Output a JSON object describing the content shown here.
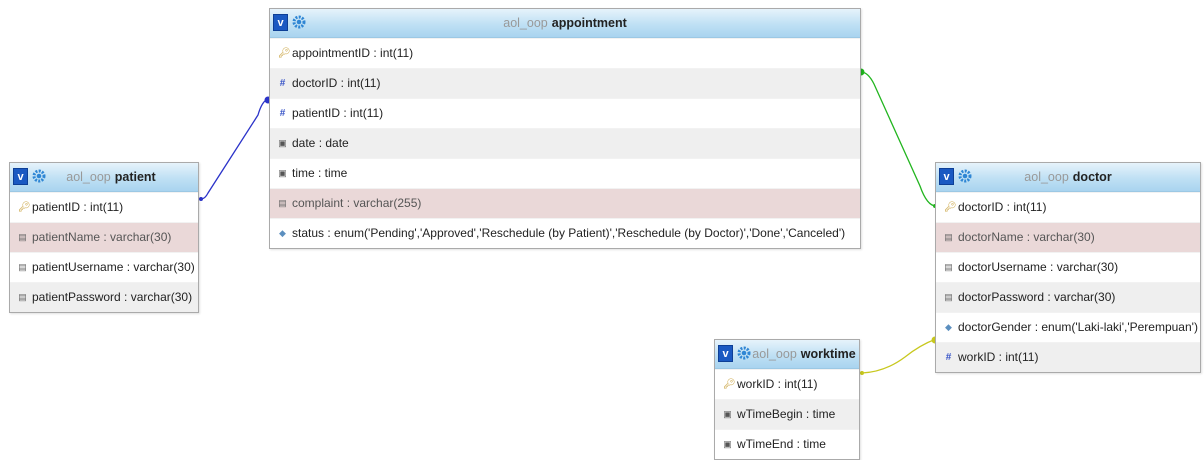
{
  "tables": {
    "appointment": {
      "db": "aol_oop",
      "name": "appointment",
      "fields": [
        {
          "icon": "primary-key-icon",
          "label": "appointmentID : int(11)"
        },
        {
          "icon": "index-icon",
          "label": "doctorID : int(11)"
        },
        {
          "icon": "index-icon",
          "label": "patientID : int(11)"
        },
        {
          "icon": "date-icon",
          "label": "date : date"
        },
        {
          "icon": "date-icon",
          "label": "time : time"
        },
        {
          "icon": "text-field-icon",
          "label": "complaint : varchar(255)"
        },
        {
          "icon": "enum-icon",
          "label": "status : enum('Pending','Approved','Reschedule (by Patient)','Reschedule (by Doctor)','Done','Canceled')"
        }
      ]
    },
    "patient": {
      "db": "aol_oop",
      "name": "patient",
      "fields": [
        {
          "icon": "primary-key-icon",
          "label": "patientID : int(11)"
        },
        {
          "icon": "text-field-icon",
          "label": "patientName : varchar(30)"
        },
        {
          "icon": "text-field-icon",
          "label": "patientUsername : varchar(30)"
        },
        {
          "icon": "text-field-icon",
          "label": "patientPassword : varchar(30)"
        }
      ]
    },
    "doctor": {
      "db": "aol_oop",
      "name": "doctor",
      "fields": [
        {
          "icon": "primary-key-icon",
          "label": "doctorID : int(11)"
        },
        {
          "icon": "text-field-icon",
          "label": "doctorName : varchar(30)"
        },
        {
          "icon": "text-field-icon",
          "label": "doctorUsername : varchar(30)"
        },
        {
          "icon": "text-field-icon",
          "label": "doctorPassword : varchar(30)"
        },
        {
          "icon": "enum-icon",
          "label": "doctorGender : enum('Laki-laki','Perempuan')"
        },
        {
          "icon": "index-icon",
          "label": "workID : int(11)"
        }
      ]
    },
    "worktime": {
      "db": "aol_oop",
      "name": "worktime",
      "fields": [
        {
          "icon": "primary-key-icon",
          "label": "workID : int(11)"
        },
        {
          "icon": "date-icon",
          "label": "wTimeBegin : time"
        },
        {
          "icon": "date-icon",
          "label": "wTimeEnd : time"
        }
      ]
    }
  },
  "toggle_label": "v",
  "relations": [
    {
      "from": "appointment.patientID",
      "to": "patient.patientID",
      "color": "#2b33c9"
    },
    {
      "from": "appointment.doctorID",
      "to": "doctor.doctorID",
      "color": "#22b51f"
    },
    {
      "from": "doctor.workID",
      "to": "worktime.workID",
      "color": "#c8c81e"
    }
  ]
}
